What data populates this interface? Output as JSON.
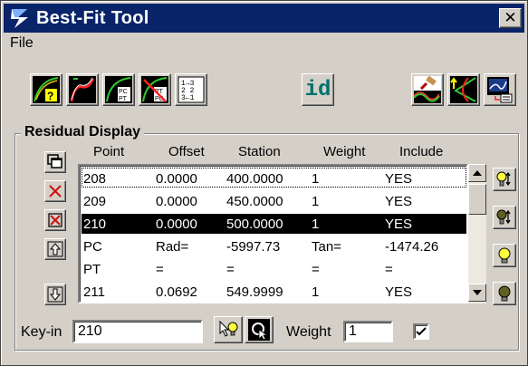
{
  "window": {
    "title": "Best-Fit Tool",
    "close_glyph": "✕"
  },
  "menu": {
    "file": "File"
  },
  "toolbar": {
    "tools": [
      {
        "icon": "best-fit-query-icon"
      },
      {
        "icon": "best-fit-curve-icon"
      },
      {
        "icon": "pc-pt-icon"
      },
      {
        "icon": "pt-pc-icon"
      },
      {
        "icon": "renumber-points-icon"
      },
      {
        "id_label": "id",
        "icon": "identify-icon"
      },
      {
        "icon": "profile-paint-icon"
      },
      {
        "icon": "tangent-icon"
      },
      {
        "icon": "report-icon"
      }
    ]
  },
  "residual_display": {
    "group_label": "Residual Display",
    "columns": [
      "Point",
      "Offset",
      "Station",
      "Weight",
      "Include"
    ],
    "rows": [
      [
        "208",
        "0.0000",
        "400.0000",
        "1",
        "YES"
      ],
      [
        "209",
        "0.0000",
        "450.0000",
        "1",
        "YES"
      ],
      [
        "210",
        "0.0000",
        "500.0000",
        "1",
        "YES"
      ],
      [
        "PC",
        "Rad=",
        "-5997.73",
        "Tan=",
        "-1474.26"
      ],
      [
        "PT",
        "=",
        "=",
        "=",
        "="
      ],
      [
        "211",
        "0.0692",
        "549.9999",
        "1",
        "YES"
      ]
    ],
    "selected_row_index": 2
  },
  "keyin": {
    "label": "Key-in",
    "value": "210"
  },
  "weight": {
    "label": "Weight",
    "value": "1",
    "include_checked": true
  },
  "colors": {
    "titlebar": "#0a246a",
    "selection": "#000000",
    "face": "#d4d0c8"
  }
}
